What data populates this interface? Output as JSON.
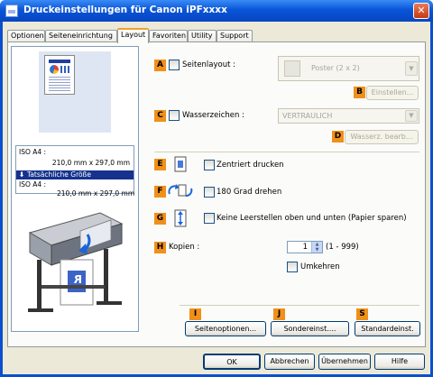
{
  "window": {
    "title": "Druckeinstellungen für Canon iPFxxxx",
    "close_glyph": "✕"
  },
  "tabs": [
    {
      "label": "Optionen",
      "active": false
    },
    {
      "label": "Seiteneinrichtung",
      "active": false
    },
    {
      "label": "Layout",
      "active": true
    },
    {
      "label": "Favoriten",
      "active": false
    },
    {
      "label": "Utility",
      "active": false
    },
    {
      "label": "Support",
      "active": false
    }
  ],
  "preview": {
    "original_size_name": "ISO A4 :",
    "original_size_dims": "210,0 mm x 297,0 mm",
    "actual_size_band": "Tatsächliche Größe",
    "actual_size_name": "ISO A4 :",
    "actual_size_dims": "210,0 mm x 297,0 mm",
    "printed_page_glyph": "R"
  },
  "layout": {
    "page_layout": {
      "badge": "A",
      "label": "Seitenlayout :",
      "checked": false,
      "value": "Poster (2 x 2)"
    },
    "settings_button": {
      "badge": "B",
      "label": "Einstellen..."
    },
    "watermark": {
      "badge": "C",
      "label": "Wasserzeichen :",
      "checked": false,
      "value": "VERTRAULICH"
    },
    "watermark_edit_button": {
      "badge": "D",
      "label": "Wasserz. bearb..."
    },
    "center_print": {
      "badge": "E",
      "label": "Zentriert drucken",
      "checked": false
    },
    "rotate_180": {
      "badge": "F",
      "label": "180 Grad drehen",
      "checked": false
    },
    "no_blank_space": {
      "badge": "G",
      "label": "Keine Leerstellen oben und unten (Papier sparen)",
      "checked": false
    },
    "copies": {
      "badge": "H",
      "label": "Kopien :",
      "value": "1",
      "range": "(1 - 999)"
    },
    "reverse": {
      "label": "Umkehren",
      "checked": false
    },
    "page_options_button": {
      "badge": "I",
      "label": "Seitenoptionen..."
    },
    "special_settings_button": {
      "badge": "J",
      "label": "Sondereinst...."
    },
    "defaults_button": {
      "badge": "S",
      "label": "Standardeinst."
    }
  },
  "footer": {
    "ok": "OK",
    "cancel": "Abbrechen",
    "apply": "Übernehmen",
    "help": "Hilfe"
  },
  "colors": {
    "title_bar": "#0a55d8",
    "badge": "#f0901a",
    "selection_band": "#16328e"
  }
}
